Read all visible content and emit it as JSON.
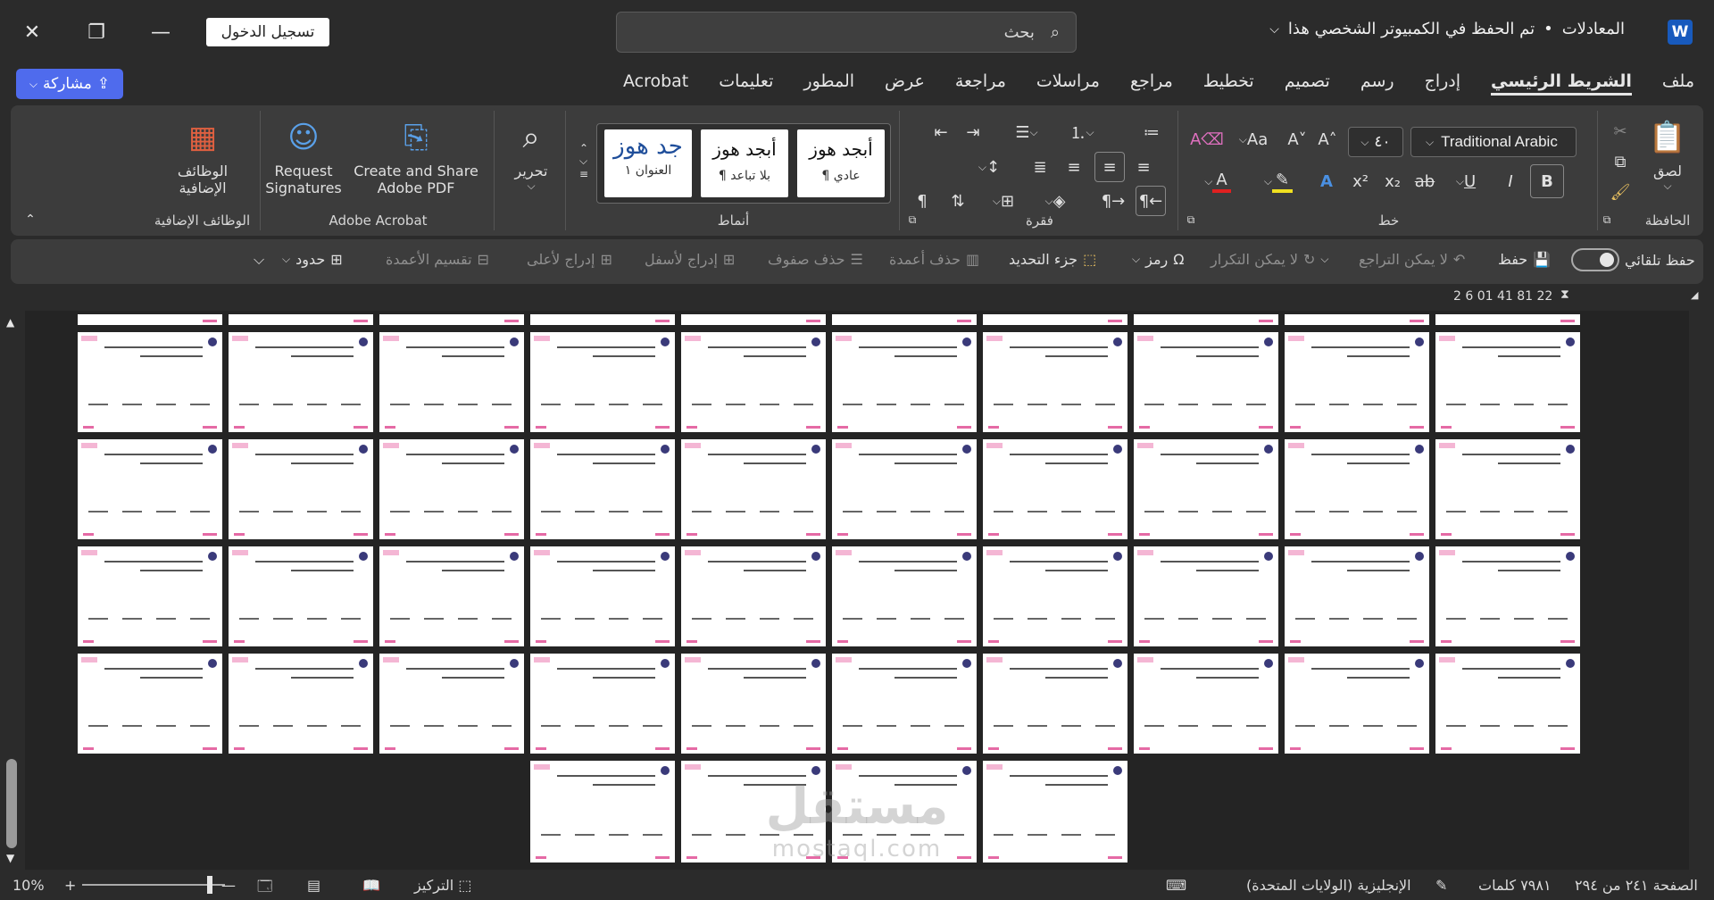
{
  "titlebar": {
    "doc_title": "المعادلات",
    "save_status": "تم الحفظ في الكمبيوتر الشخصي هذا",
    "search_placeholder": "بحث",
    "signin_label": "تسجيل الدخول",
    "app_letter": "W"
  },
  "tabs": [
    "ملف",
    "الشريط الرئيسي",
    "إدراج",
    "رسم",
    "تصميم",
    "تخطيط",
    "مراجع",
    "مراسلات",
    "مراجعة",
    "عرض",
    "المطور",
    "تعليمات",
    "Acrobat"
  ],
  "active_tab": "الشريط الرئيسي",
  "share_label": "مشاركة",
  "ribbon": {
    "clipboard": {
      "label": "الحافظة",
      "paste": "لصق"
    },
    "font": {
      "label": "خط",
      "font_name": "Traditional Arabic",
      "font_size": "٤٠"
    },
    "paragraph": {
      "label": "فقرة"
    },
    "styles": {
      "label": "أنماط",
      "cards": [
        {
          "sample": "أبجد هوز",
          "name": "¶ عادي"
        },
        {
          "sample": "أبجد هوز",
          "name": "¶ بلا تباعد"
        },
        {
          "sample": "جد هوز",
          "name": "العنوان ١"
        }
      ]
    },
    "editing": {
      "label": "تحرير"
    },
    "acrobat": {
      "label": "Adobe Acrobat",
      "create_share": "Create and Share Adobe PDF",
      "request_sig": "Request Signatures"
    },
    "addins": {
      "label": "الوظائف الإضافية",
      "button": "الوظائف الإضافية"
    }
  },
  "qat": {
    "autosave": "حفظ تلقائي",
    "save": "حفظ",
    "undo": "لا يمكن التراجع",
    "redo": "لا يمكن التكرار",
    "symbol": "رمز",
    "selection_pane": "جزء التحديد",
    "delete_columns": "حذف أعمدة",
    "delete_rows": "حذف صفوف",
    "insert_below": "إدراج لأسفل",
    "insert_above": "إدراج لأعلى",
    "split_columns": "تقسيم الأعمدة",
    "borders": "حدود"
  },
  "ruler": {
    "marks": "2   6   01  41  81  22"
  },
  "watermark": {
    "main": "مستقل",
    "sub": "mostaql.com"
  },
  "statusbar": {
    "page": "الصفحة ٢٤١ من ٢٩٤",
    "words": "٧٩٨١ كلمات",
    "language": "الإنجليزية (الولايات المتحدة)",
    "focus": "التركيز",
    "zoom": "10%"
  }
}
